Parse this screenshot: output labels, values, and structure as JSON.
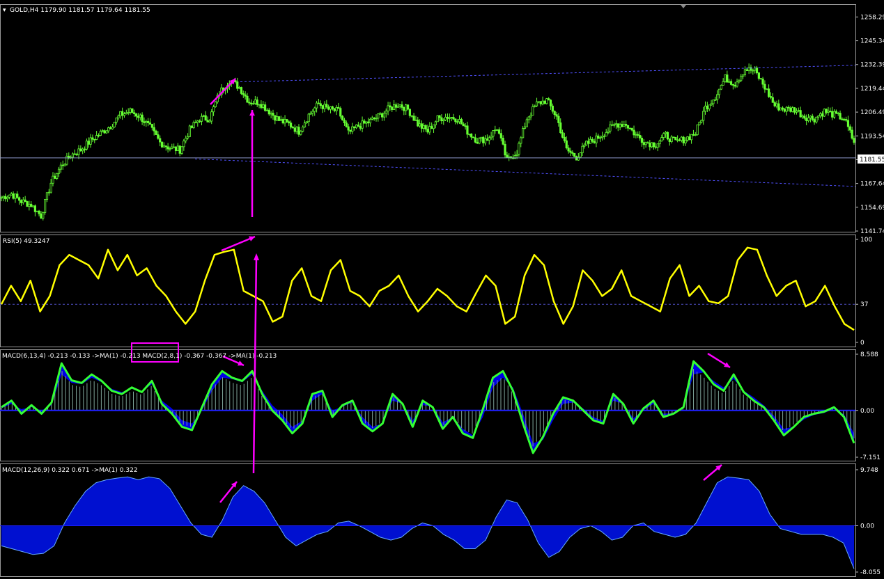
{
  "colors": {
    "background": "#000000",
    "frame": "#c0c0c0",
    "bull_candle": "#66ff33",
    "price_line": "#8c96c8",
    "channel": "#5050ff",
    "rsi_line": "#ffff00",
    "rsi_level": "#5050c8",
    "macd_fill": "#0000e6",
    "macd_line": "#33ff33",
    "macd_hist": "#7fa59a",
    "macd3_fill": "#0010d0",
    "macd3_edge": "#66aaff",
    "annotation": "#ff00ff",
    "label_text": "#ffffff",
    "price_tag_bg": "#ffffff",
    "price_tag_text": "#000000"
  },
  "header": {
    "symbol_text": "GOLD,H4  1179.90 1181.57 1179.64 1181.55"
  },
  "current_price_tag": "1181.55",
  "chart_data": [
    {
      "type": "candlestick",
      "symbol": "GOLD,H4",
      "ohlc_last": [
        1179.9,
        1181.57,
        1179.64,
        1181.55
      ],
      "y_ticks": [
        "1258.29",
        "1245.34",
        "1232.39",
        "1219.44",
        "1206.49",
        "1193.54",
        "1180.59",
        "1167.64",
        "1154.69",
        "1141.74"
      ],
      "ylim": [
        1141.74,
        1264.5
      ],
      "current_price": 1181.55,
      "approx_close": [
        1160,
        1162,
        1158,
        1156,
        1150,
        1168,
        1177,
        1183,
        1186,
        1191,
        1195,
        1199,
        1205,
        1207,
        1204,
        1198,
        1190,
        1187,
        1186,
        1197,
        1203,
        1203,
        1217,
        1224,
        1220,
        1212,
        1212,
        1207,
        1202,
        1200,
        1196,
        1205,
        1211,
        1208,
        1207,
        1195,
        1199,
        1201,
        1204,
        1208,
        1211,
        1208,
        1200,
        1196,
        1203,
        1204,
        1203,
        1196,
        1191,
        1192,
        1198,
        1180,
        1185,
        1203,
        1211,
        1213,
        1204,
        1186,
        1182,
        1189,
        1192,
        1196,
        1200,
        1200,
        1194,
        1190,
        1189,
        1194,
        1190,
        1192,
        1195,
        1209,
        1215,
        1225,
        1222,
        1230,
        1229,
        1220,
        1210,
        1208,
        1208,
        1204,
        1203,
        1207,
        1205,
        1203,
        1190
      ],
      "channel_upper": [
        [
          1.0,
          1223.0
        ],
        [
          3.0,
          1232.0
        ]
      ],
      "channel_lower": [
        [
          1.0,
          1181.0
        ],
        [
          3.0,
          1166.0
        ]
      ],
      "annotations": [
        "higher high arrow on price",
        "vertical guide line"
      ]
    },
    {
      "type": "line",
      "title": "RSI(5) 49.3247",
      "y_ticks": [
        "100",
        "37",
        "0"
      ],
      "level": 37,
      "ylim": [
        0,
        100
      ],
      "approx_values": [
        37,
        55,
        40,
        60,
        30,
        45,
        75,
        85,
        80,
        75,
        62,
        90,
        70,
        85,
        65,
        72,
        55,
        45,
        30,
        18,
        30,
        60,
        85,
        88,
        90,
        50,
        45,
        40,
        20,
        25,
        60,
        72,
        45,
        40,
        70,
        80,
        50,
        45,
        35,
        50,
        55,
        65,
        45,
        30,
        40,
        52,
        45,
        35,
        30,
        48,
        65,
        55,
        18,
        25,
        65,
        85,
        75,
        40,
        18,
        35,
        70,
        60,
        45,
        52,
        70,
        45,
        40,
        35,
        30,
        62,
        75,
        45,
        55,
        40,
        38,
        45,
        80,
        92,
        90,
        65,
        45,
        55,
        60,
        35,
        40,
        55,
        35,
        18,
        12
      ]
    },
    {
      "type": "area",
      "title": "MACD(6,13,4) -0.213 -0.133  ->MA(1) -0.213  MACD(2,8,1) -0.367 -0.367  ->MA(1) -0.213",
      "y_ticks": [
        "8.588",
        "0.00",
        "-7.151"
      ],
      "ylim": [
        -7.151,
        8.588
      ],
      "series": [
        {
          "approx_values": [
            0.5,
            1.5,
            -0.5,
            0.8,
            -0.5,
            1.2,
            7.2,
            4.6,
            4.2,
            5.5,
            4.5,
            3.0,
            2.5,
            3.5,
            2.8,
            4.5,
            1.0,
            -0.5,
            -2.5,
            -3.0,
            0.5,
            4.0,
            6.0,
            5.0,
            4.5,
            6.0,
            2.5,
            0.0,
            -1.5,
            -3.5,
            -2.0,
            2.5,
            3.0,
            -1.0,
            0.8,
            1.5,
            -2.0,
            -3.2,
            -2.0,
            2.5,
            1.0,
            -2.5,
            1.5,
            0.5,
            -2.8,
            -1.0,
            -3.5,
            -4.2,
            0.2,
            5.0,
            6.0,
            3.0,
            -2.0,
            -6.5,
            -4.0,
            -0.5,
            2.0,
            1.5,
            0.0,
            -1.5,
            -2.0,
            2.5,
            1.0,
            -2.0,
            0.3,
            1.5,
            -1.0,
            -0.5,
            0.5,
            7.5,
            6.0,
            4.0,
            3.0,
            5.5,
            2.8,
            1.5,
            0.5,
            -1.5,
            -3.8,
            -2.5,
            -1.0,
            -0.5,
            -0.2,
            0.5,
            -1.0,
            -5.0
          ]
        },
        {
          "approx_values": [
            0.3,
            1.0,
            0.2,
            0.5,
            0.0,
            0.8,
            5.5,
            4.2,
            4.0,
            5.0,
            4.3,
            3.3,
            2.8,
            3.3,
            2.9,
            4.0,
            1.5,
            0.3,
            -1.5,
            -2.0,
            0.0,
            3.0,
            5.0,
            4.8,
            4.3,
            5.5,
            3.0,
            0.8,
            -0.6,
            -2.5,
            -1.6,
            1.5,
            2.5,
            0.0,
            0.6,
            1.2,
            -1.0,
            -2.5,
            -2.0,
            1.5,
            1.0,
            -1.5,
            0.8,
            0.6,
            -1.8,
            -1.0,
            -2.8,
            -3.8,
            -1.0,
            3.5,
            5.0,
            3.5,
            -0.5,
            -5.0,
            -4.5,
            -1.5,
            1.0,
            1.2,
            0.3,
            -1.0,
            -1.6,
            1.5,
            1.0,
            -1.2,
            0.0,
            1.0,
            -0.5,
            -0.4,
            0.3,
            5.5,
            5.8,
            4.5,
            3.5,
            4.8,
            3.0,
            2.0,
            0.8,
            -0.8,
            -2.8,
            -2.5,
            -1.4,
            -0.7,
            -0.4,
            0.2,
            -0.6,
            -3.5
          ]
        }
      ],
      "annotations": [
        "highlight box around MACD(2,8,1)",
        "lower high arrow"
      ]
    },
    {
      "type": "area",
      "title": "MACD(12,26,9) 0.322 0.671  ->MA(1) 0.322",
      "y_ticks": [
        "9.748",
        "0.00",
        "-8.055"
      ],
      "ylim": [
        -8.055,
        9.748
      ],
      "approx_values": [
        -3.5,
        -4.0,
        -4.5,
        -5.0,
        -4.8,
        -3.5,
        0.5,
        3.5,
        6.0,
        7.5,
        8.0,
        8.3,
        8.5,
        8.0,
        8.5,
        8.2,
        6.5,
        3.5,
        0.5,
        -1.5,
        -2.0,
        1.0,
        5.0,
        7.0,
        6.0,
        4.0,
        1.0,
        -2.0,
        -3.5,
        -2.5,
        -1.5,
        -1.0,
        0.5,
        0.8,
        0.0,
        -1.0,
        -2.0,
        -2.5,
        -2.0,
        -0.5,
        0.5,
        0.0,
        -1.5,
        -2.5,
        -4.0,
        -4.0,
        -2.5,
        1.5,
        4.5,
        4.0,
        1.0,
        -3.0,
        -5.5,
        -4.5,
        -2.0,
        -0.5,
        0.0,
        -1.0,
        -2.5,
        -2.0,
        0.0,
        0.5,
        -1.0,
        -1.5,
        -2.0,
        -1.5,
        0.5,
        4.0,
        7.5,
        8.5,
        8.3,
        8.0,
        6.0,
        2.0,
        -0.5,
        -1.0,
        -1.5,
        -1.5,
        -1.5,
        -2.0,
        -3.0,
        -7.5
      ],
      "annotations": [
        "higher high arrow"
      ]
    }
  ]
}
